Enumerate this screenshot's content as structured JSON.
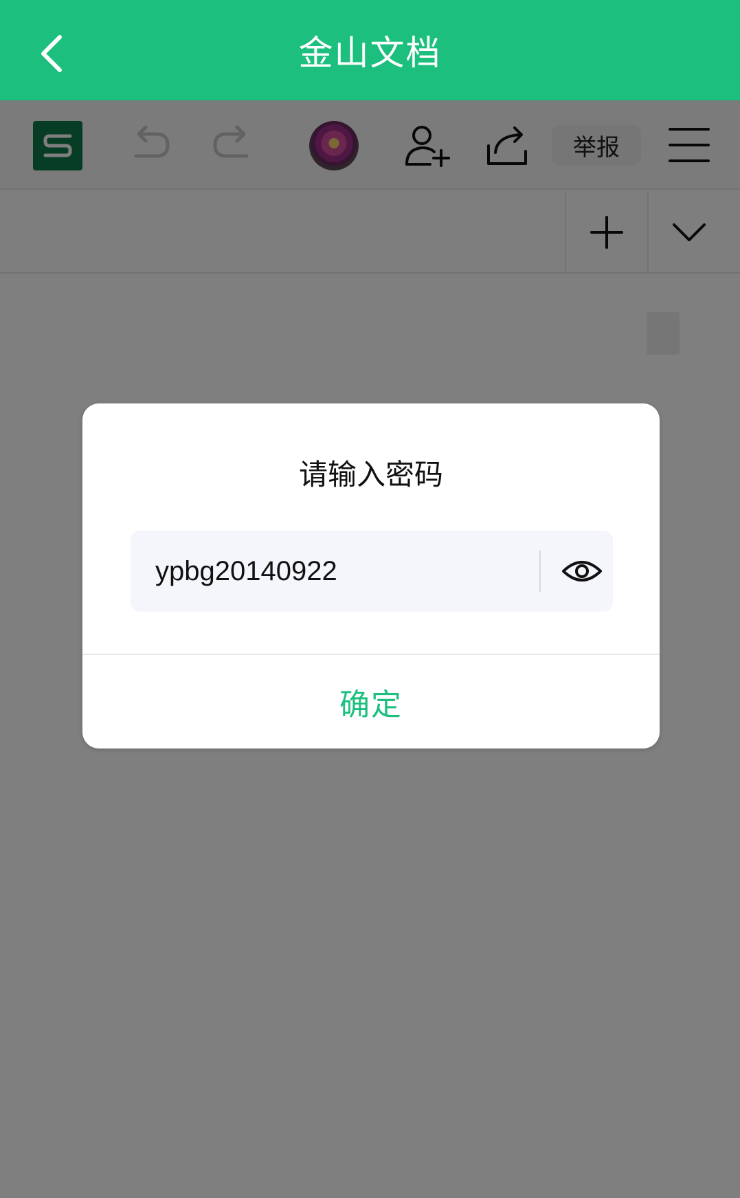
{
  "app": {
    "title": "金山文档"
  },
  "toolbar": {
    "report_label": "举报",
    "logo_letter": "S"
  },
  "dialog": {
    "title": "请输入密码",
    "password_value": "ypbg20140922",
    "confirm_label": "确定"
  },
  "colors": {
    "brand_green": "#1dbf7e",
    "logo_green": "#0f7a48"
  },
  "icons": [
    "back-arrow-icon",
    "sheet-logo-icon",
    "undo-icon",
    "redo-icon",
    "avatar",
    "add-user-icon",
    "share-icon",
    "menu-icon",
    "add-sheet-icon",
    "chevron-down-icon",
    "eye-icon"
  ]
}
